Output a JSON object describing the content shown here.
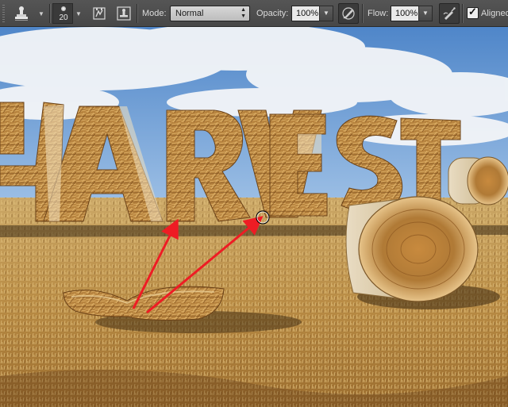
{
  "options_bar": {
    "tool_icon": "clone-stamp-icon",
    "brush": {
      "size": "20",
      "icon": "soft-round-brush-icon"
    },
    "panel_icons": [
      "toggle-brush-panel-icon",
      "toggle-clone-source-panel-icon"
    ],
    "mode": {
      "label": "Mode:",
      "value": "Normal"
    },
    "opacity": {
      "label": "Opacity:",
      "value": "100%"
    },
    "tablet_opacity_icon": "tablet-pressure-opacity-icon",
    "flow": {
      "label": "Flow:",
      "value": "100%"
    },
    "airbrush_icon": "airbrush-icon",
    "aligned": {
      "label": "Aligned",
      "checked": true
    }
  },
  "canvas": {
    "scene": "hay-harvest-field",
    "overlay": {
      "cursor_icon": "circle-brush-cursor-icon",
      "arrow_color": "#ee1c24",
      "arrow_count": 2
    }
  }
}
